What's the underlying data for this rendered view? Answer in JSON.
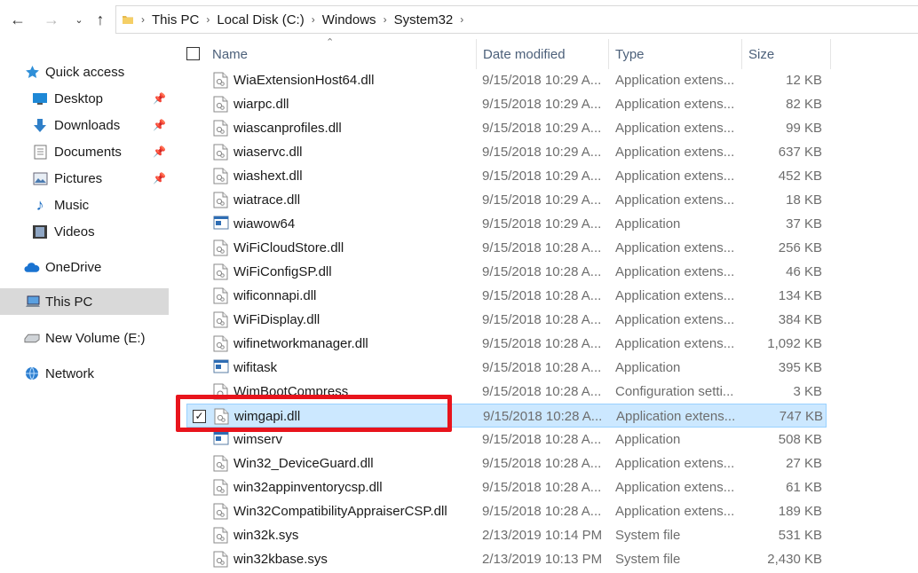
{
  "address": {
    "crumbs": [
      "This PC",
      "Local Disk (C:)",
      "Windows",
      "System32"
    ]
  },
  "sidebar": {
    "items": [
      {
        "label": "Quick access",
        "icon": "star-icon"
      },
      {
        "label": "Desktop",
        "icon": "desktop-icon",
        "pinned": true
      },
      {
        "label": "Downloads",
        "icon": "download-arrow-icon",
        "pinned": true
      },
      {
        "label": "Documents",
        "icon": "document-icon",
        "pinned": true
      },
      {
        "label": "Pictures",
        "icon": "picture-icon",
        "pinned": true
      },
      {
        "label": "Music",
        "icon": "music-note-icon"
      },
      {
        "label": "Videos",
        "icon": "film-icon"
      },
      {
        "label": "OneDrive",
        "icon": "cloud-icon"
      },
      {
        "label": "This PC",
        "icon": "computer-icon",
        "selected": true
      },
      {
        "label": "New Volume (E:)",
        "icon": "drive-icon"
      },
      {
        "label": "Network",
        "icon": "network-icon"
      }
    ]
  },
  "columns": {
    "name": "Name",
    "date": "Date modified",
    "type": "Type",
    "size": "Size"
  },
  "files": [
    {
      "name": "WiaExtensionHost64.dll",
      "date": "9/15/2018 10:29 A...",
      "type": "Application extens...",
      "size": "12 KB",
      "kind": "dll"
    },
    {
      "name": "wiarpc.dll",
      "date": "9/15/2018 10:29 A...",
      "type": "Application extens...",
      "size": "82 KB",
      "kind": "dll"
    },
    {
      "name": "wiascanprofiles.dll",
      "date": "9/15/2018 10:29 A...",
      "type": "Application extens...",
      "size": "99 KB",
      "kind": "dll"
    },
    {
      "name": "wiaservc.dll",
      "date": "9/15/2018 10:29 A...",
      "type": "Application extens...",
      "size": "637 KB",
      "kind": "dll"
    },
    {
      "name": "wiashext.dll",
      "date": "9/15/2018 10:29 A...",
      "type": "Application extens...",
      "size": "452 KB",
      "kind": "dll"
    },
    {
      "name": "wiatrace.dll",
      "date": "9/15/2018 10:29 A...",
      "type": "Application extens...",
      "size": "18 KB",
      "kind": "dll"
    },
    {
      "name": "wiawow64",
      "date": "9/15/2018 10:29 A...",
      "type": "Application",
      "size": "37 KB",
      "kind": "exe"
    },
    {
      "name": "WiFiCloudStore.dll",
      "date": "9/15/2018 10:28 A...",
      "type": "Application extens...",
      "size": "256 KB",
      "kind": "dll"
    },
    {
      "name": "WiFiConfigSP.dll",
      "date": "9/15/2018 10:28 A...",
      "type": "Application extens...",
      "size": "46 KB",
      "kind": "dll"
    },
    {
      "name": "wificonnapi.dll",
      "date": "9/15/2018 10:28 A...",
      "type": "Application extens...",
      "size": "134 KB",
      "kind": "dll"
    },
    {
      "name": "WiFiDisplay.dll",
      "date": "9/15/2018 10:28 A...",
      "type": "Application extens...",
      "size": "384 KB",
      "kind": "dll"
    },
    {
      "name": "wifinetworkmanager.dll",
      "date": "9/15/2018 10:28 A...",
      "type": "Application extens...",
      "size": "1,092 KB",
      "kind": "dll"
    },
    {
      "name": "wifitask",
      "date": "9/15/2018 10:28 A...",
      "type": "Application",
      "size": "395 KB",
      "kind": "exe"
    },
    {
      "name": "WimBootCompress",
      "date": "9/15/2018 10:28 A...",
      "type": "Configuration setti...",
      "size": "3 KB",
      "kind": "ini"
    },
    {
      "name": "wimgapi.dll",
      "date": "9/15/2018 10:28 A...",
      "type": "Application extens...",
      "size": "747 KB",
      "kind": "dll",
      "selected": true
    },
    {
      "name": "wimserv",
      "date": "9/15/2018 10:28 A...",
      "type": "Application",
      "size": "508 KB",
      "kind": "exe"
    },
    {
      "name": "Win32_DeviceGuard.dll",
      "date": "9/15/2018 10:28 A...",
      "type": "Application extens...",
      "size": "27 KB",
      "kind": "dll"
    },
    {
      "name": "win32appinventorycsp.dll",
      "date": "9/15/2018 10:28 A...",
      "type": "Application extens...",
      "size": "61 KB",
      "kind": "dll"
    },
    {
      "name": "Win32CompatibilityAppraiserCSP.dll",
      "date": "9/15/2018 10:28 A...",
      "type": "Application extens...",
      "size": "189 KB",
      "kind": "dll"
    },
    {
      "name": "win32k.sys",
      "date": "2/13/2019 10:14 PM",
      "type": "System file",
      "size": "531 KB",
      "kind": "sys"
    },
    {
      "name": "win32kbase.sys",
      "date": "2/13/2019 10:13 PM",
      "type": "System file",
      "size": "2,430 KB",
      "kind": "sys"
    }
  ],
  "colors": {
    "selection": "#cce8ff",
    "selection_border": "#99d1ff",
    "highlight_box": "#e8141c",
    "header_text": "#4c607a"
  }
}
